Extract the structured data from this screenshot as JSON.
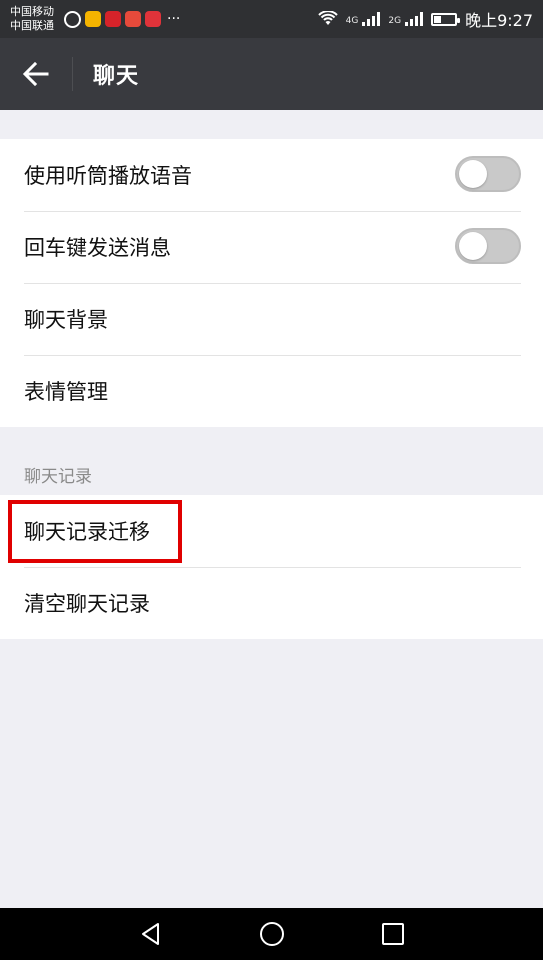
{
  "status": {
    "carrier1": "中国移动",
    "carrier2": "中国联通",
    "more": "···",
    "net1": "4G",
    "net2": "2G",
    "time": "晚上9:27"
  },
  "header": {
    "title": "聊天"
  },
  "settings": {
    "items": [
      {
        "label": "使用听筒播放语音",
        "toggle": false
      },
      {
        "label": "回车键发送消息",
        "toggle": false
      },
      {
        "label": "聊天背景"
      },
      {
        "label": "表情管理"
      }
    ]
  },
  "history": {
    "header": "聊天记录",
    "items": [
      {
        "label": "聊天记录迁移"
      },
      {
        "label": "清空聊天记录"
      }
    ]
  },
  "colors": {
    "status_bar": "#2f3033",
    "title_bar": "#393a3f",
    "background": "#efeff4",
    "highlight": "#e00000"
  },
  "icons": {
    "back": "arrow-left-icon",
    "nav_back": "triangle-back-icon",
    "nav_home": "circle-home-icon",
    "nav_recent": "square-recent-icon"
  }
}
